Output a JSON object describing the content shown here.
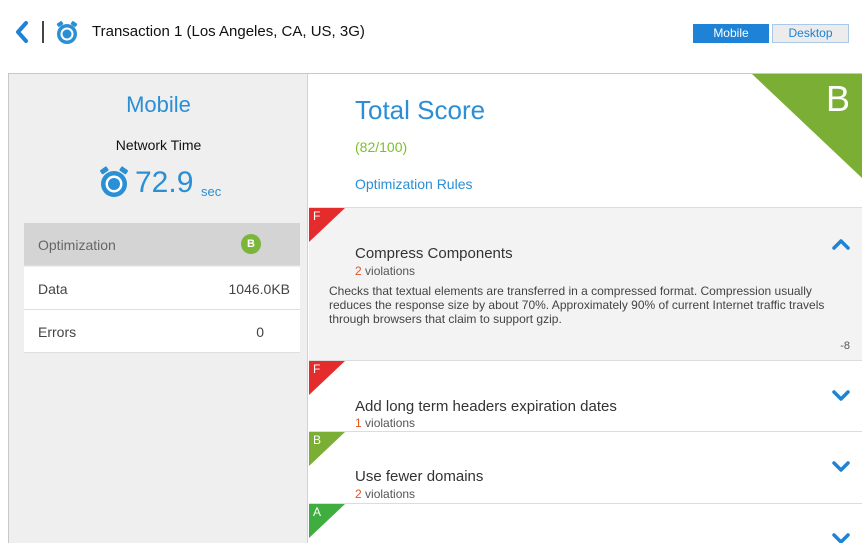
{
  "header": {
    "title": "Transaction 1 (Los Angeles, CA, US, 3G)",
    "toggle": {
      "mobile_label": "Mobile",
      "desktop_label": "Desktop",
      "active": "Mobile"
    }
  },
  "left_panel": {
    "heading": "Mobile",
    "network_time_label": "Network Time",
    "network_time_value": "72.9",
    "network_time_unit": "sec",
    "metrics": [
      {
        "label": "Optimization",
        "grade": "B"
      },
      {
        "label": "Data",
        "value": "1046.0KB"
      },
      {
        "label": "Errors",
        "value": "0"
      }
    ]
  },
  "right_panel": {
    "title": "Total Score",
    "score": "(82/100)",
    "grade": "B",
    "rules_label": "Optimization Rules",
    "rules": [
      {
        "grade": "F",
        "name": "Compress Components",
        "violations_count": "2",
        "violations_label": "violations",
        "expanded": true,
        "description": "Checks that textual elements are transferred in a compressed format. Compression usually reduces the response size by about 70%. Approximately 90% of current Internet traffic travels through browsers that claim to support gzip.",
        "points": "-8"
      },
      {
        "grade": "F",
        "name": "Add long term headers expiration dates",
        "violations_count": "1",
        "violations_label": "violations",
        "expanded": false
      },
      {
        "grade": "B",
        "name": "Use fewer domains",
        "violations_count": "2",
        "violations_label": "violations",
        "expanded": false
      },
      {
        "grade": "A",
        "name": "",
        "expanded": false
      }
    ]
  },
  "colors": {
    "accent": "#1e82d6",
    "title_blue": "#2a8fd4",
    "grade_f": "#e52c2c",
    "grade_b": "#7aae34",
    "grade_a": "#3fad3f",
    "violation_count": "#e25425"
  },
  "icons": [
    "chevron-left-icon",
    "stopwatch-icon",
    "chevron-up-icon",
    "chevron-down-icon"
  ]
}
